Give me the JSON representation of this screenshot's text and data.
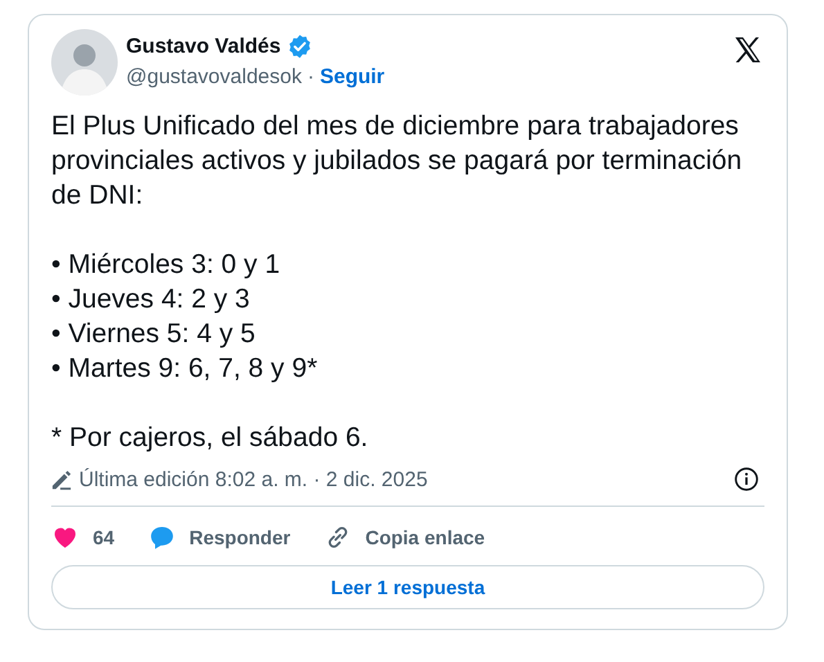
{
  "author": {
    "name": "Gustavo Valdés",
    "verified": true,
    "handle": "@gustavovaldesok",
    "separator": "·",
    "follow": "Seguir"
  },
  "body": {
    "intro": "El Plus Unificado del mes de diciembre para trabajadores provinciales activos y jubilados se pagará por terminación de DNI:",
    "bullets": [
      "• Miércoles 3: 0 y 1",
      "• Jueves 4: 2 y 3",
      "• Viernes 5: 4 y 5",
      "• Martes 9: 6, 7, 8 y 9*"
    ],
    "footnote": "* Por cajeros, el sábado 6."
  },
  "edited": "Última edición 8:02 a. m. · 2 dic. 2025",
  "actions": [
    {
      "kind": "like",
      "label": "64"
    },
    {
      "kind": "reply",
      "label": "Responder"
    },
    {
      "kind": "link",
      "label": "Copia enlace"
    }
  ],
  "read_button": "Leer 1 respuesta"
}
